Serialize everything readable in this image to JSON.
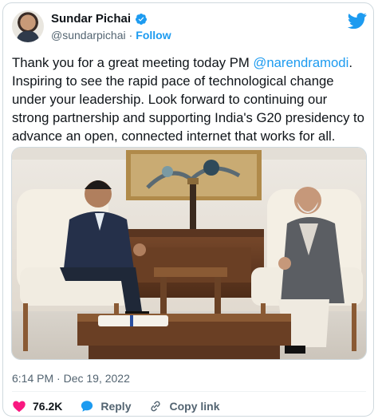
{
  "author": {
    "name": "Sundar Pichai",
    "handle": "@sundarpichai",
    "separator": "·",
    "follow_label": "Follow"
  },
  "tweet": {
    "text_before_mention": "Thank you for a great meeting today PM ",
    "mention": "@narendramodi",
    "text_after_mention": ". Inspiring to see the rapid pace of technological change under your leadership. Look forward to continuing our strong partnership and supporting India's G20 presidency to advance an open, connected internet that works for all.",
    "timestamp": "6:14 PM · Dec 19, 2022"
  },
  "actions": {
    "likes_count": "76.2K",
    "reply_label": "Reply",
    "copy_link_label": "Copy link"
  },
  "icons": {
    "verified": "verified-badge-icon",
    "platform": "twitter-bird-icon",
    "like": "heart-icon",
    "reply": "reply-bubble-icon",
    "copy": "link-icon"
  },
  "colors": {
    "accent": "#1d9bf0",
    "like": "#f91880",
    "muted": "#536471"
  }
}
